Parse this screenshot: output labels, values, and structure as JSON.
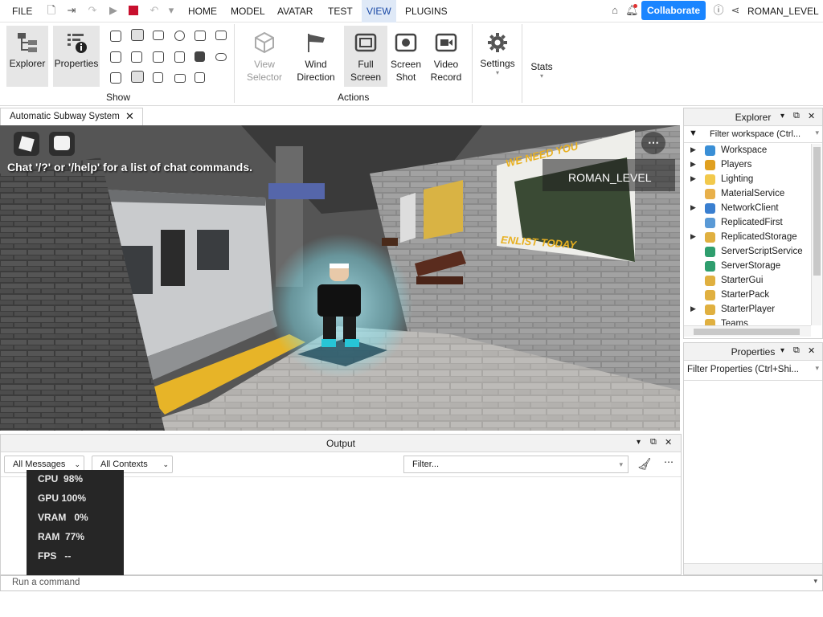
{
  "menubar": {
    "file": "FILE",
    "tabs": [
      "HOME",
      "MODEL",
      "AVATAR",
      "TEST",
      "VIEW",
      "PLUGINS"
    ],
    "active_tab": "VIEW",
    "collaborate": "Collaborate",
    "username": "ROMAN_LEVEL"
  },
  "ribbon": {
    "show": {
      "explorer": "Explorer",
      "properties": "Properties",
      "label": "Show"
    },
    "actions": {
      "view_selector": "View Selector",
      "wind_direction": "Wind Direction",
      "full_screen": "Full Screen",
      "screen_shot": "Screen Shot",
      "video_record": "Video Record",
      "label": "Actions"
    },
    "settings": "Settings",
    "stats": "Stats"
  },
  "document_tab": {
    "title": "Automatic Subway System"
  },
  "viewport": {
    "chat_hint": "Chat '/?' or '/help' for a list of chat commands.",
    "player_name": "ROMAN_LEVEL",
    "poster_text_top": "WE NEED YOU",
    "poster_text_bottom": "ENLIST TODAY"
  },
  "output": {
    "title": "Output",
    "messages_filter": "All Messages",
    "contexts_filter": "All Contexts",
    "filter_placeholder": "Filter..."
  },
  "perf": {
    "cpu_label": "CPU",
    "cpu": "98%",
    "gpu_label": "GPU",
    "gpu": "100%",
    "vram_label": "VRAM",
    "vram": "0%",
    "ram_label": "RAM",
    "ram": "77%",
    "fps_label": "FPS",
    "fps": "--"
  },
  "command_bar": {
    "placeholder": "Run a command"
  },
  "explorer": {
    "title": "Explorer",
    "filter": "Filter workspace (Ctrl...",
    "items": [
      {
        "label": "Workspace",
        "color": "#3a8fd6",
        "expandable": true
      },
      {
        "label": "Players",
        "color": "#e0a020",
        "expandable": true
      },
      {
        "label": "Lighting",
        "color": "#f2c94c",
        "expandable": true
      },
      {
        "label": "MaterialService",
        "color": "#e8b04a",
        "expandable": false
      },
      {
        "label": "NetworkClient",
        "color": "#3a7fd0",
        "expandable": true
      },
      {
        "label": "ReplicatedFirst",
        "color": "#5a9ad6",
        "expandable": false
      },
      {
        "label": "ReplicatedStorage",
        "color": "#e0b040",
        "expandable": true
      },
      {
        "label": "ServerScriptService",
        "color": "#2f9e6e",
        "expandable": false
      },
      {
        "label": "ServerStorage",
        "color": "#2f9e6e",
        "expandable": false
      },
      {
        "label": "StarterGui",
        "color": "#e0b040",
        "expandable": false
      },
      {
        "label": "StarterPack",
        "color": "#e0b040",
        "expandable": false
      },
      {
        "label": "StarterPlayer",
        "color": "#e0b040",
        "expandable": true
      },
      {
        "label": "Teams",
        "color": "#e0b040",
        "expandable": false
      }
    ]
  },
  "properties": {
    "title": "Properties",
    "filter": "Filter Properties (Ctrl+Shi..."
  }
}
